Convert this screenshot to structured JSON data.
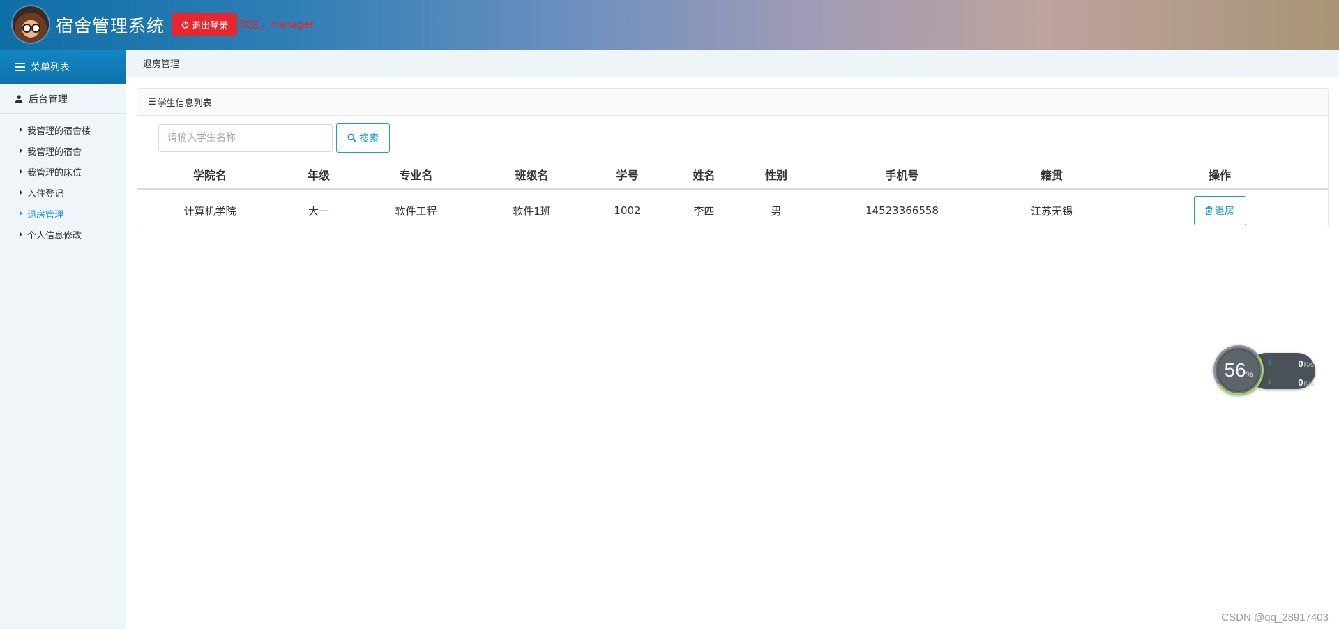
{
  "header": {
    "title": "宿舍管理系统",
    "logout_label": "退出登录",
    "welcome_text": "欢迎，",
    "username": "manager"
  },
  "sidebar": {
    "menu_title": "菜单列表",
    "section_title": "后台管理",
    "items": [
      {
        "label": "我管理的宿舍楼",
        "active": false
      },
      {
        "label": "我管理的宿舍",
        "active": false
      },
      {
        "label": "我管理的床位",
        "active": false
      },
      {
        "label": "入住登记",
        "active": false
      },
      {
        "label": "退房管理",
        "active": true
      },
      {
        "label": "个人信息修改",
        "active": false
      }
    ]
  },
  "breadcrumb": "退房管理",
  "panel": {
    "title": "学生信息列表",
    "search": {
      "placeholder": "请输入学生名称",
      "value": "",
      "button_label": "搜索"
    },
    "table": {
      "headers": [
        "学院名",
        "年级",
        "专业名",
        "班级名",
        "学号",
        "姓名",
        "性别",
        "手机号",
        "籍贯",
        "操作"
      ],
      "rows": [
        [
          "计算机学院",
          "大一",
          "软件工程",
          "软件1班",
          "1002",
          "李四",
          "男",
          "14523366558",
          "江苏无锡"
        ]
      ],
      "action_label": "退房"
    }
  },
  "speed_widget": {
    "percent": "56",
    "percent_sign": "%",
    "upload_value": "0",
    "download_value": "0",
    "unit": "K/s"
  },
  "watermark": "CSDN @qq_28917403",
  "colors": {
    "accent": "#1e9bd7",
    "danger": "#e8262d",
    "welcome": "#e0262c"
  }
}
